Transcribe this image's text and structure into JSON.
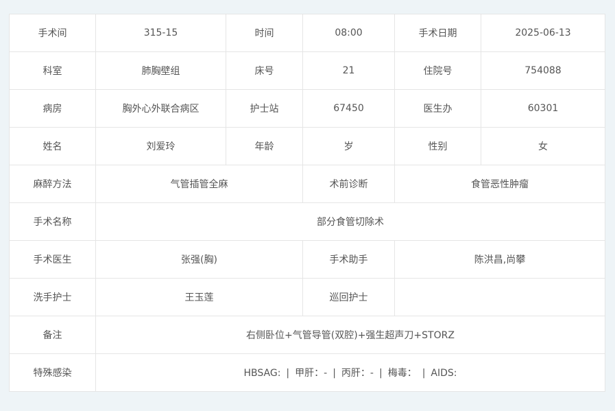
{
  "labels": {
    "room": "手术间",
    "time": "时间",
    "date": "手术日期",
    "dept": "科室",
    "bed": "床号",
    "admission": "住院号",
    "ward": "病房",
    "nurse_station": "护士站",
    "doctor_office": "医生办",
    "name": "姓名",
    "age": "年龄",
    "gender": "性别",
    "anesthesia": "麻醉方法",
    "diagnosis": "术前诊断",
    "surgery_name": "手术名称",
    "surgeon": "手术医生",
    "assistant": "手术助手",
    "scrub_nurse": "洗手护士",
    "circulating_nurse": "巡回护士",
    "remarks": "备注",
    "infection": "特殊感染"
  },
  "values": {
    "room": "315-15",
    "time": "08:00",
    "date": "2025-06-13",
    "dept": "肺胸壁组",
    "bed": "21",
    "admission": "754088",
    "ward": "胸外心外联合病区",
    "nurse_station": "67450",
    "doctor_office": "60301",
    "name": "刘爱玲",
    "age": "岁",
    "gender": "女",
    "anesthesia": "气管插管全麻",
    "diagnosis": "食管恶性肿瘤",
    "surgery_name": "部分食管切除术",
    "surgeon": "张强(胸)",
    "assistant": "陈洪昌,尚攀",
    "scrub_nurse": "王玉莲",
    "circulating_nurse": "",
    "remarks": "右侧卧位+气管导管(双腔)+强生超声刀+STORZ"
  },
  "infection": {
    "hbsag": "HBSAG: ",
    "hepatitis_a": "甲肝：-",
    "hepatitis_c": "丙肝：-",
    "syphilis": "梅毒：",
    "aids": "AIDS:",
    "separator": "|"
  }
}
